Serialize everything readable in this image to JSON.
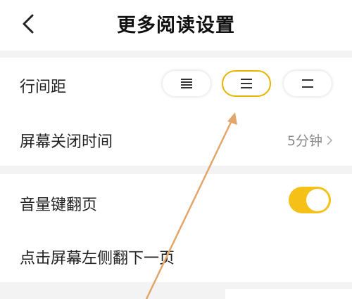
{
  "header": {
    "title": "更多阅读设置",
    "back_icon": "chevron-left-icon"
  },
  "settings": {
    "line_spacing": {
      "label": "行间距",
      "options": [
        "small-spacing-icon",
        "medium-spacing-icon",
        "large-spacing-icon"
      ],
      "selected": 1
    },
    "screen_off": {
      "label": "屏幕关闭时间",
      "value": "5分钟"
    },
    "volume_key": {
      "label": "音量键翻页",
      "enabled": true
    },
    "tap_left": {
      "label": "点击屏幕左侧翻下一页"
    }
  },
  "colors": {
    "accent": "#f5c018",
    "active_border": "#e8b400",
    "annotation_arrow": "#e2a56a"
  }
}
